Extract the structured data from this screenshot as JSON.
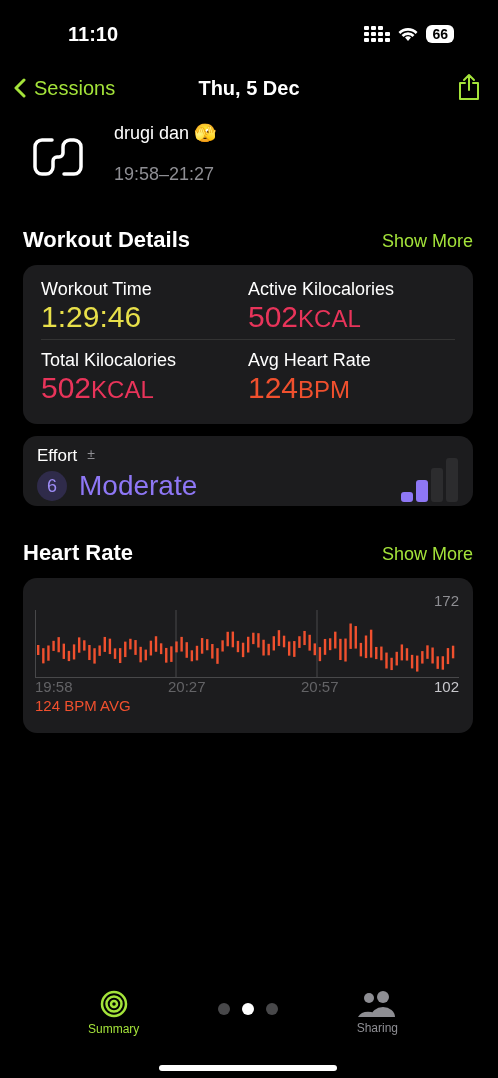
{
  "status_bar": {
    "time": "11:10",
    "battery": "66"
  },
  "nav": {
    "back": "Sessions",
    "title": "Thu, 5 Dec"
  },
  "session": {
    "name": "drugi dan 🫣",
    "time_range": "19:58–21:27"
  },
  "workout_details": {
    "heading": "Workout Details",
    "show_more": "Show More",
    "metrics": [
      {
        "label": "Workout Time",
        "value": "1:29:46",
        "color": "#e8e04a"
      },
      {
        "label": "Active Kilocalories",
        "value": "502",
        "unit": "KCAL",
        "color": "#e8345a"
      },
      {
        "label": "Total Kilocalories",
        "value": "502",
        "unit": "KCAL",
        "color": "#e8345a"
      },
      {
        "label": "Avg Heart Rate",
        "value": "124",
        "unit": "BPM",
        "color": "#f0502e"
      }
    ]
  },
  "effort": {
    "label": "Effort",
    "adjust": "±",
    "score": "6",
    "rating": "Moderate",
    "level": 0.5
  },
  "heart_rate": {
    "heading": "Heart Rate",
    "show_more": "Show More",
    "max": "172",
    "min": "102",
    "times": [
      "19:58",
      "20:27",
      "20:57"
    ],
    "average": "124 BPM AVG"
  },
  "tab_bar": {
    "tabs": [
      {
        "label": "Summary",
        "selected": true
      },
      {
        "label": "Sharing",
        "selected": false
      }
    ],
    "pages": [
      {
        "selected": false
      },
      {
        "selected": true
      },
      {
        "selected": false
      }
    ]
  }
}
